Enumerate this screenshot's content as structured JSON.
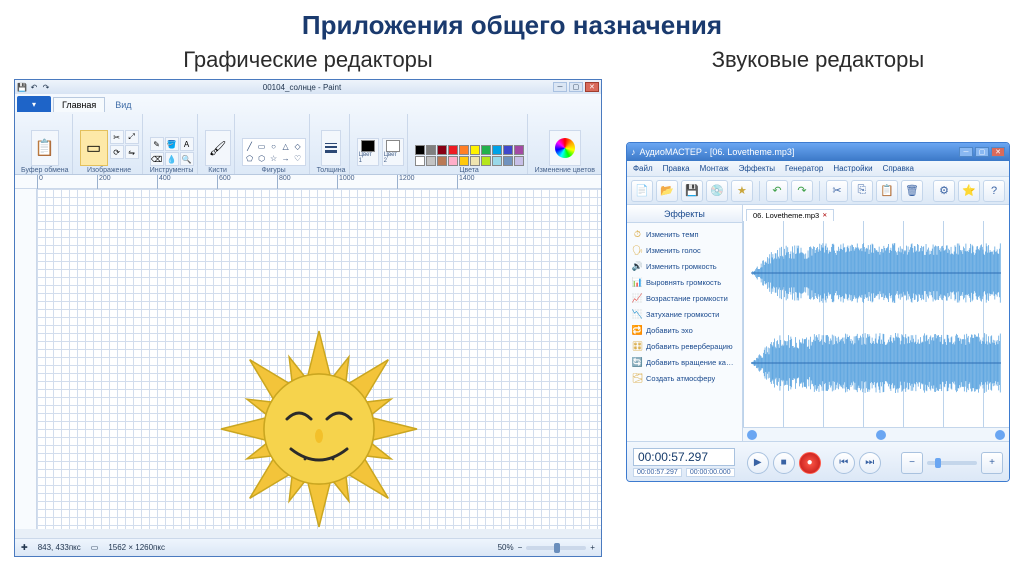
{
  "page_title": "Приложения общего назначения",
  "left_heading": "Графические редакторы",
  "right_heading": "Звуковые редакторы",
  "paint": {
    "window_title": "00104_солнце - Paint",
    "tabs": {
      "app": "",
      "home": "Главная",
      "view": "Вид"
    },
    "groups": {
      "clipboard": "Буфер обмена",
      "image": "Изображение",
      "tools": "Инструменты",
      "brushes": "Кисти",
      "shapes": "Фигуры",
      "weight": "Толщина",
      "color1_label": "Цвет 1",
      "color2_label": "Цвет 2",
      "colors": "Цвета",
      "editcolors": "Изменение цветов"
    },
    "select_label": "Выделить",
    "ruler_ticks": [
      0,
      200,
      400,
      600,
      800,
      1000,
      1200,
      1400
    ],
    "palette_row1": [
      "#000000",
      "#7f7f7f",
      "#880015",
      "#ed1c24",
      "#ff7f27",
      "#fff200",
      "#22b14c",
      "#00a2e8",
      "#3f48cc",
      "#a349a4"
    ],
    "palette_row2": [
      "#ffffff",
      "#c3c3c3",
      "#b97a57",
      "#ffaec9",
      "#ffc90e",
      "#efe4b0",
      "#b5e61d",
      "#99d9ea",
      "#7092be",
      "#c8bfe7"
    ],
    "color1": "#000000",
    "color2": "#ffffff",
    "status": {
      "pos": "843, 433пкс",
      "size": "1562 × 1260пкс",
      "zoom": "50%"
    }
  },
  "audio": {
    "window_title": "АудиоМАСТЕР - [06. Lovetheme.mp3]",
    "menu": [
      "Файл",
      "Правка",
      "Монтаж",
      "Эффекты",
      "Генератор",
      "Настройки",
      "Справка"
    ],
    "fx_header": "Эффекты",
    "fx_items": [
      "Изменить темп",
      "Изменить голос",
      "Изменить громкость",
      "Выровнять громкость",
      "Возрастание громкости",
      "Затухание громкости",
      "Добавить эхо",
      "Добавить реверберацию",
      "Добавить вращение каналов",
      "Создать атмосферу"
    ],
    "file_tab": "06. Lovetheme.mp3",
    "timecode": "00:00:57.297",
    "timecode_small_a": "00:00:57.297",
    "timecode_small_b": "00:00:00.000"
  }
}
